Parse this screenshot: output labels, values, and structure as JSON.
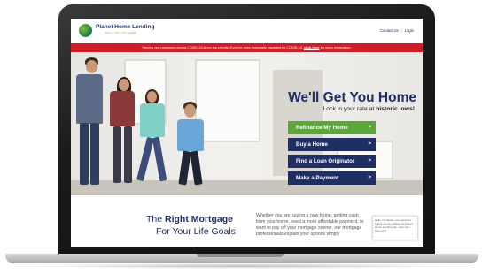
{
  "site": {
    "logo_text": "Planet Home Lending",
    "logo_tagline": "WE'LL GET YOU HOME",
    "nav": [
      "Contact Us",
      "Login"
    ]
  },
  "alert": {
    "text": "Serving our customers during COVID-19 is our top priority. If you've been financially impacted by COVID-19,",
    "link": "click here",
    "suffix": "for more information."
  },
  "hero": {
    "headline": "We'll Get You Home",
    "subline_prefix": "Lock in your rate at",
    "subline_emphasis": "historic lows!",
    "buttons": [
      {
        "label": "Refinance My Home",
        "style": "green"
      },
      {
        "label": "Buy a Home",
        "style": "navy"
      },
      {
        "label": "Find a Loan Originator",
        "style": "navy"
      },
      {
        "label": "Make a Payment",
        "style": "navy"
      }
    ],
    "arrow": ">"
  },
  "lower": {
    "tagline_the": "The",
    "tagline_emphasis": "Right Mortgage",
    "tagline_line2": "For Your Life Goals",
    "paragraph": "Whether you are buying a new home, getting cash from your home, need a more affordable payment, or want to pay off your mortgage sooner, our mortgage professionals explain your options simply",
    "chat": "Hello, I'm Stella, your assistant. Thank you for visiting our Planet Home Lending site. How can I help you?"
  },
  "colors": {
    "navy": "#1f2e63",
    "green": "#5aa83a",
    "alert_red": "#cf1f25"
  }
}
